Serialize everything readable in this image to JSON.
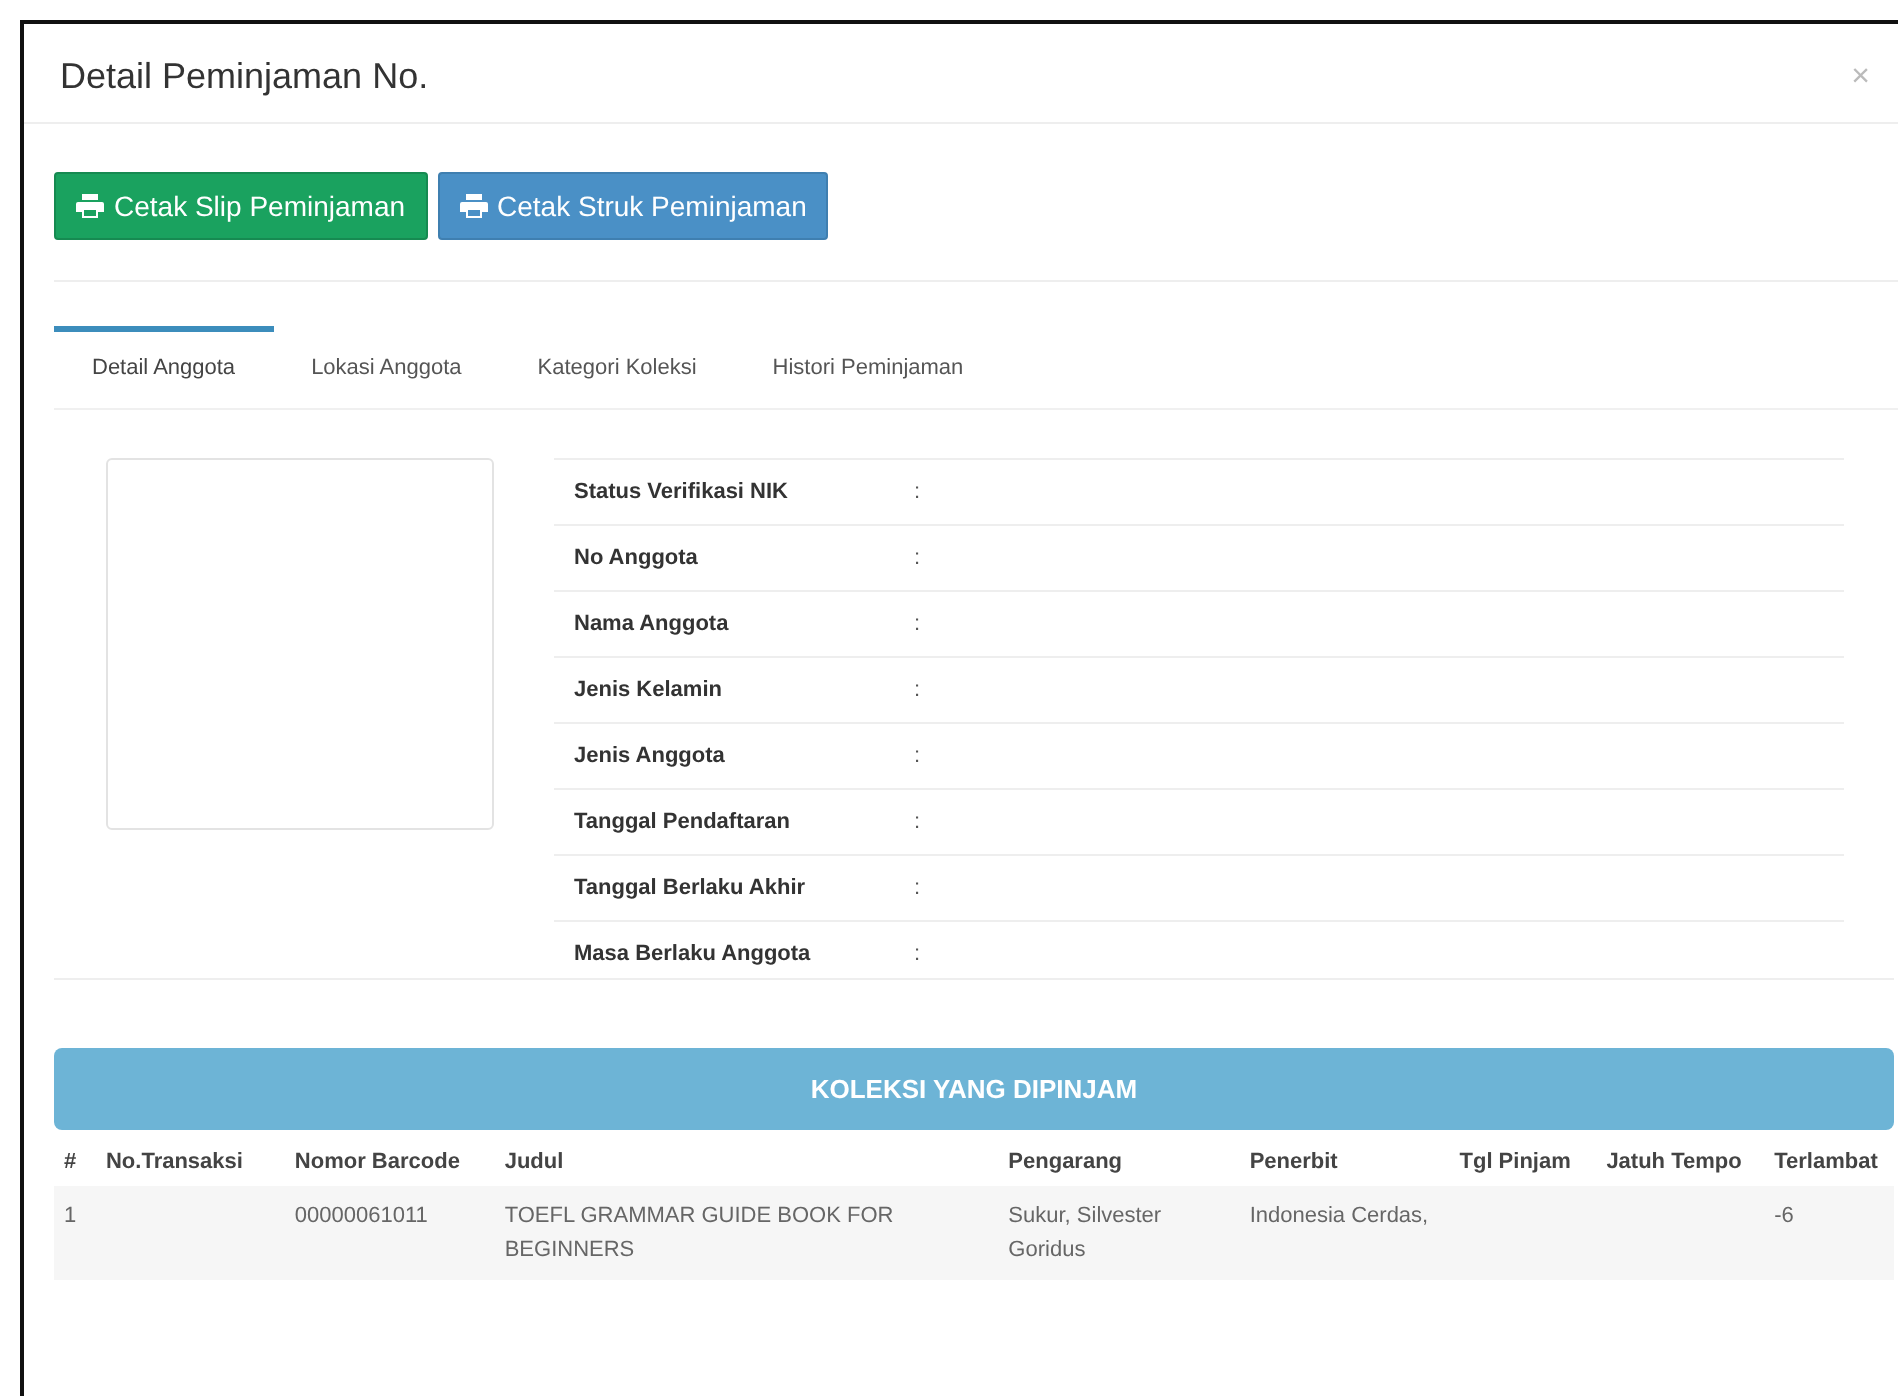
{
  "modal": {
    "title": "Detail Peminjaman No.",
    "close": "×"
  },
  "buttons": [
    {
      "label": "Cetak Slip Peminjaman",
      "kind": "success"
    },
    {
      "label": "Cetak Struk Peminjaman",
      "kind": "info"
    }
  ],
  "tabs": [
    {
      "label": "Detail Anggota",
      "selected": true
    },
    {
      "label": "Lokasi Anggota",
      "selected": false
    },
    {
      "label": "Kategori Koleksi",
      "selected": false
    },
    {
      "label": "Histori Peminjaman",
      "selected": false
    }
  ],
  "details": [
    {
      "label": "Status Verifikasi NIK",
      "sep": ":"
    },
    {
      "label": "No Anggota",
      "sep": ":"
    },
    {
      "label": "Nama Anggota",
      "sep": ":"
    },
    {
      "label": "Jenis Kelamin",
      "sep": ":"
    },
    {
      "label": "Jenis Anggota",
      "sep": ":"
    },
    {
      "label": "Tanggal Pendaftaran",
      "sep": ":"
    },
    {
      "label": "Tanggal Berlaku Akhir",
      "sep": ":"
    },
    {
      "label": "Masa Berlaku Anggota",
      "sep": ":"
    }
  ],
  "collection": {
    "title": "KOLEKSI YANG DIPINJAM",
    "columns": [
      "#",
      "No.Transaksi",
      "Nomor Barcode",
      "Judul",
      "Pengarang",
      "Penerbit",
      "Tgl Pinjam",
      "Jatuh Tempo",
      "Terlambat"
    ],
    "rows": [
      [
        "1",
        "",
        "00000061011",
        "TOEFL GRAMMAR GUIDE BOOK FOR BEGINNERS",
        "Sukur, Silvester Goridus",
        "Indonesia Cerdas,",
        "",
        "",
        "-6"
      ]
    ]
  }
}
